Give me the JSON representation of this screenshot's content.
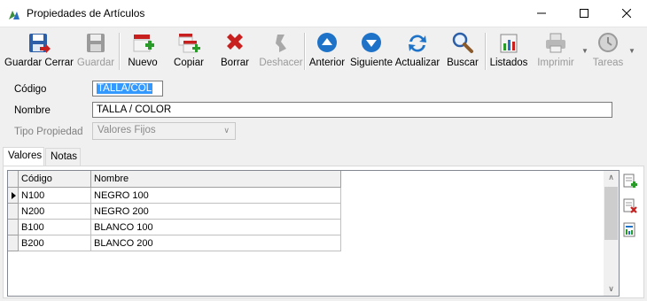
{
  "window": {
    "title": "Propiedades de Artículos",
    "controls": {
      "minimize": "minimize-icon",
      "maximize": "maximize-icon",
      "close": "close-icon"
    }
  },
  "toolbar": {
    "items": [
      {
        "label": "Guardar Cerrar",
        "icon": "save-close-icon",
        "enabled": true
      },
      {
        "label": "Guardar",
        "icon": "save-icon",
        "enabled": false
      },
      {
        "label": "Nuevo",
        "icon": "new-icon",
        "enabled": true
      },
      {
        "label": "Copiar",
        "icon": "copy-icon",
        "enabled": true
      },
      {
        "label": "Borrar",
        "icon": "delete-icon",
        "enabled": true
      },
      {
        "label": "Deshacer",
        "icon": "undo-icon",
        "enabled": false
      },
      {
        "label": "Anterior",
        "icon": "previous-icon",
        "enabled": true
      },
      {
        "label": "Siguiente",
        "icon": "next-icon",
        "enabled": true
      },
      {
        "label": "Actualizar",
        "icon": "refresh-icon",
        "enabled": true
      },
      {
        "label": "Buscar",
        "icon": "search-icon",
        "enabled": true
      },
      {
        "label": "Listados",
        "icon": "reports-icon",
        "enabled": true
      },
      {
        "label": "Imprimir",
        "icon": "printer-icon",
        "enabled": false
      },
      {
        "label": "Tareas",
        "icon": "tasks-icon",
        "enabled": false
      }
    ]
  },
  "form": {
    "codigo": {
      "label": "Código",
      "value": "TALLA/COL"
    },
    "nombre": {
      "label": "Nombre",
      "value": "TALLA / COLOR"
    },
    "tipo": {
      "label": "Tipo Propiedad",
      "value": "Valores Fijos"
    }
  },
  "tabs": [
    {
      "label": "Valores",
      "active": true
    },
    {
      "label": "Notas",
      "active": false
    }
  ],
  "grid": {
    "columns": [
      "Código",
      "Nombre"
    ],
    "rows": [
      {
        "codigo": "N100",
        "nombre": "NEGRO 100",
        "current": true
      },
      {
        "codigo": "N200",
        "nombre": "NEGRO 200",
        "current": false
      },
      {
        "codigo": "B100",
        "nombre": "BLANCO 100",
        "current": false
      },
      {
        "codigo": "B200",
        "nombre": "BLANCO 200",
        "current": false
      }
    ]
  },
  "side_actions": [
    {
      "icon": "add-row-icon"
    },
    {
      "icon": "delete-row-icon"
    },
    {
      "icon": "edit-row-icon"
    }
  ],
  "colors": {
    "accent_blue": "#1e73c8",
    "delete_red": "#c8201e",
    "add_green": "#2a9a2a",
    "selection": "#3399ff"
  }
}
